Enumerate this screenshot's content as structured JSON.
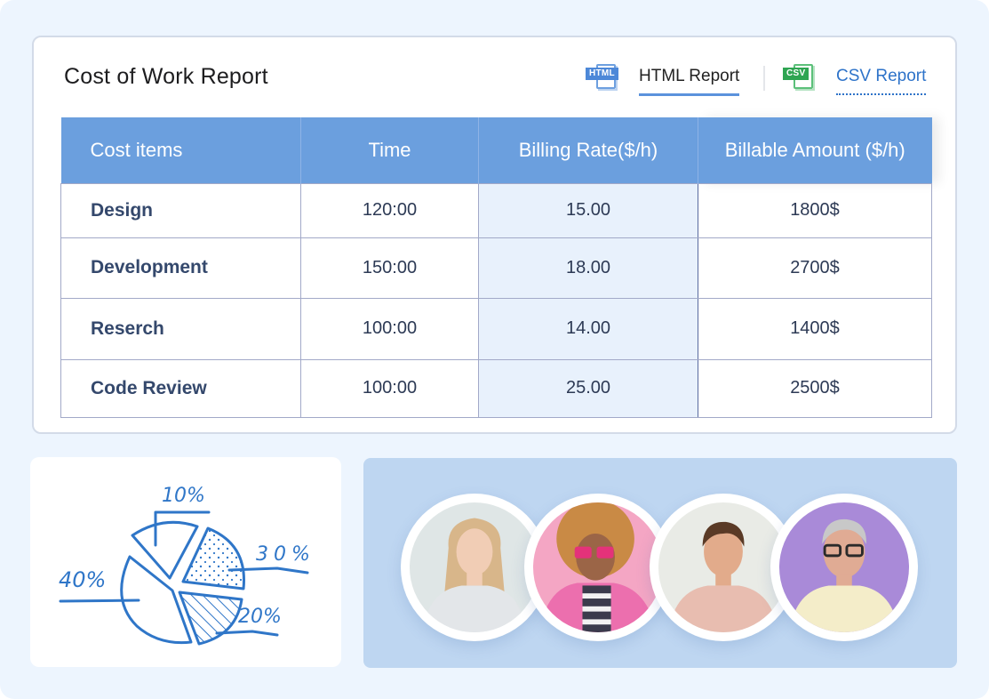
{
  "report": {
    "title": "Cost of Work Report",
    "export_tabs": [
      {
        "icon": "html-file-icon",
        "badge": "HTML",
        "label": "HTML Report",
        "active": true
      },
      {
        "icon": "csv-file-icon",
        "badge": "CSV",
        "label": "CSV Report",
        "active": false
      }
    ],
    "table": {
      "headers": [
        "Cost items",
        "Time",
        "Billing Rate($/h)",
        "Billable Amount ($/h)"
      ],
      "rows": [
        {
          "item": "Design",
          "time": "120:00",
          "rate": "15.00",
          "amount": "1800$"
        },
        {
          "item": "Development",
          "time": "150:00",
          "rate": "18.00",
          "amount": "2700$"
        },
        {
          "item": "Reserch",
          "time": "100:00",
          "rate": "14.00",
          "amount": "1400$"
        },
        {
          "item": "Code Review",
          "time": "100:00",
          "rate": "25.00",
          "amount": "2500$"
        }
      ]
    }
  },
  "pie_sketch": {
    "slices": [
      {
        "label": "10%",
        "value": 10,
        "fill": "outline"
      },
      {
        "label": "30%",
        "value": 30,
        "fill": "dotted"
      },
      {
        "label": "20%",
        "value": 20,
        "fill": "hatched"
      },
      {
        "label": "40%",
        "value": 40,
        "fill": "outline"
      }
    ],
    "stroke_color": "#2f76c8"
  },
  "team": {
    "avatars": [
      {
        "name": "avatar-woman-blonde",
        "bg": "#dfe6e6",
        "skin": "#f1cdb5",
        "hair": "#d8b68a",
        "shirt": "#e3e6e9"
      },
      {
        "name": "avatar-woman-curly-pink-glasses",
        "bg": "#f4a6c4",
        "skin": "#9b6547",
        "hair": "#c98a45",
        "shirt": "#ec6fae"
      },
      {
        "name": "avatar-man-smiling",
        "bg": "#e9ebe6",
        "skin": "#e2ab8b",
        "hair": "#5a3a26",
        "shirt": "#e8bdb0"
      },
      {
        "name": "avatar-older-man-glasses",
        "bg": "#a98ad8",
        "skin": "#e0ab94",
        "hair": "#c8c8c8",
        "shirt": "#f4edc9"
      }
    ]
  },
  "colors": {
    "page_bg": "#edf5fe",
    "header_bg": "#6b9fde",
    "accent_blue": "#2e73c9",
    "csv_green": "#2fa552"
  }
}
